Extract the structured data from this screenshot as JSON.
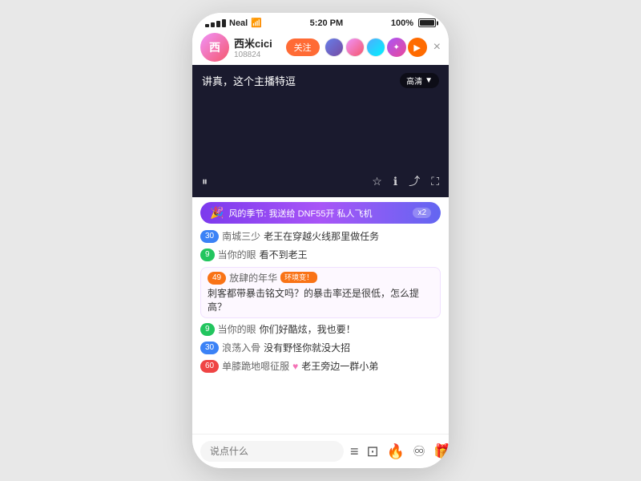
{
  "statusBar": {
    "carrier": "Neal",
    "wifi": "wifi",
    "time": "5:20 PM",
    "battery": "100%"
  },
  "header": {
    "streamerName": "西米cici",
    "streamerId": "108824",
    "followLabel": "关注",
    "closeLabel": "×"
  },
  "video": {
    "title": "讲真，这个主播特逗",
    "quality": "高清",
    "qualityArrow": "▼"
  },
  "giftBanner": {
    "icon": "🎉",
    "text": "风的季节: 我送给 DNF55开 私人飞机",
    "count": "x2"
  },
  "messages": [
    {
      "badgeText": "30",
      "badgeClass": "badge-blue",
      "name": "南城三少",
      "content": "老王在穿越火线那里做任务"
    },
    {
      "badgeText": "9",
      "badgeClass": "badge-green",
      "name": "当你的眼",
      "content": "看不到老王"
    },
    {
      "badgeText": "49",
      "badgeClass": "badge-orange",
      "name": "放肆的年华",
      "tag": "环境变！",
      "tagClass": "msg-tag-orange",
      "content": "刺客都带暴击铭文吗？的暴击率还是很低，怎么提高？",
      "isBlock": true
    },
    {
      "badgeText": "9",
      "badgeClass": "badge-green",
      "name": "当你的眼",
      "content": "你们好酷炫，我也要！"
    },
    {
      "badgeText": "30",
      "badgeClass": "badge-blue",
      "name": "浪荡入骨",
      "content": "没有野怪你就没大招"
    },
    {
      "badgeText": "60",
      "badgeClass": "badge-red",
      "name": "单膝跪地嗯征服",
      "heart": "♥",
      "content": "老王旁边一群小弟"
    }
  ],
  "bottomBar": {
    "placeholder": "说点什么",
    "icons": {
      "menu": "≡",
      "message": "⊡",
      "fire": "🔥",
      "emoji": "♾",
      "gift": "🎁"
    }
  }
}
